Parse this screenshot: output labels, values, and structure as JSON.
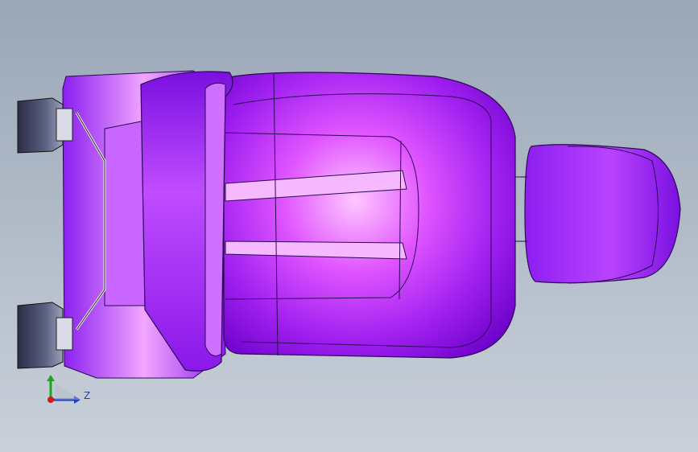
{
  "viewport": {
    "background_top": "#9aa7b7",
    "background_bottom": "#c9d0da",
    "model_color": "#a020f0",
    "model_highlight": "#ffb3ff",
    "model_shadow": "#6a00c8",
    "bracket_color": "#3b3f5c"
  },
  "triad": {
    "axis_label": "Z",
    "colors": {
      "x": "#1a3fd1",
      "y": "#1ea51e",
      "origin": "#d11a1a"
    }
  }
}
